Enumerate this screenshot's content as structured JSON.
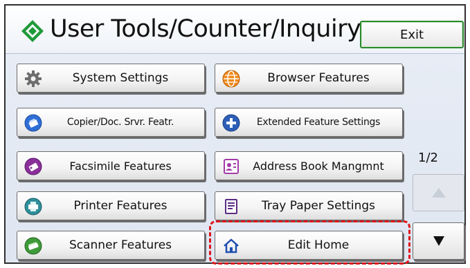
{
  "header": {
    "title": "User Tools/Counter/Inquiry",
    "title_icon": "tools-diamond-icon",
    "exit_label": "Exit"
  },
  "buttons": [
    {
      "label": "System Settings",
      "icon": "gear-icon"
    },
    {
      "label": "Browser Features",
      "icon": "globe-icon"
    },
    {
      "label": "Copier/Doc. Srvr. Featr.",
      "icon": "copier-icon"
    },
    {
      "label": "Extended Feature Settings",
      "icon": "plus-circle-icon"
    },
    {
      "label": "Facsimile Features",
      "icon": "fax-icon"
    },
    {
      "label": "Address Book Mangmnt",
      "icon": "address-book-icon"
    },
    {
      "label": "Printer Features",
      "icon": "printer-icon"
    },
    {
      "label": "Tray Paper Settings",
      "icon": "tray-paper-icon"
    },
    {
      "label": "Scanner Features",
      "icon": "scanner-icon"
    },
    {
      "label": "Edit Home",
      "icon": "home-icon"
    }
  ],
  "pager": {
    "indicator": "1/2",
    "up_icon": "triangle-up-icon",
    "down_icon": "triangle-down-icon"
  },
  "colors": {
    "highlight": "#e0131a",
    "exit_border": "#2b8a2b"
  }
}
